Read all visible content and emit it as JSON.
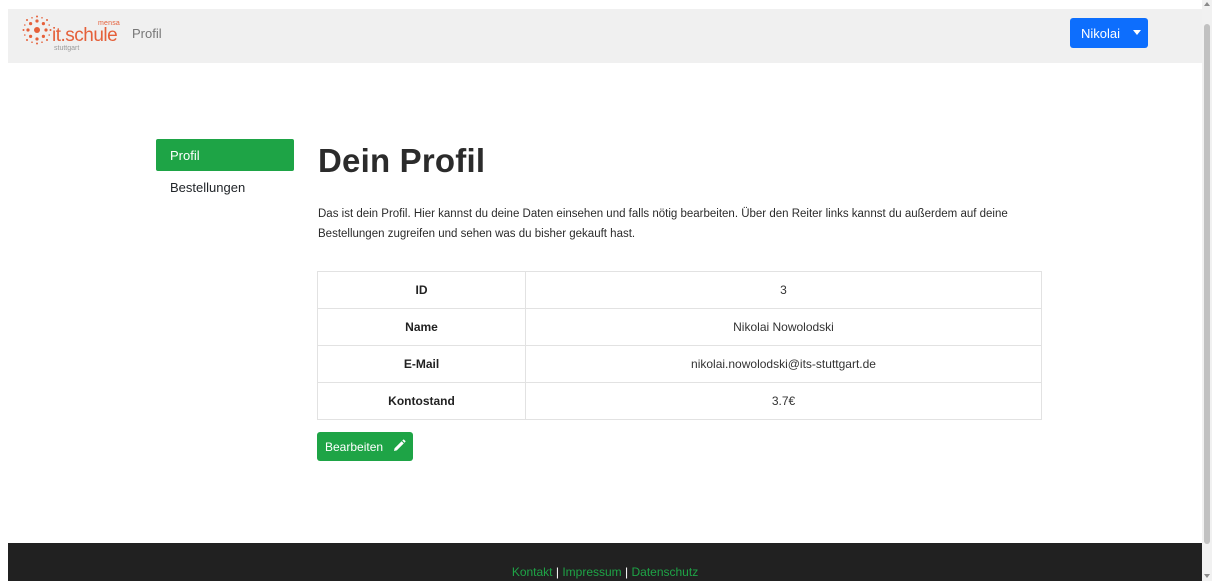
{
  "navbar": {
    "logo": {
      "mensa": "mensa",
      "itschule": "it.schule",
      "stuttgart": "stuttgart"
    },
    "page_title": "Profil",
    "user_menu": {
      "label": "Nikolai"
    }
  },
  "sidebar": {
    "items": [
      {
        "label": "Profil",
        "active": true
      },
      {
        "label": "Bestellungen",
        "active": false
      }
    ]
  },
  "main": {
    "title": "Dein Profil",
    "intro": "Das ist dein Profil. Hier kannst du deine Daten einsehen und falls nötig bearbeiten. Über den Reiter links kannst du außerdem auf deine Bestellungen zugreifen und sehen was du bisher gekauft hast.",
    "table": [
      {
        "key": "ID",
        "value": "3"
      },
      {
        "key": "Name",
        "value": "Nikolai Nowolodski"
      },
      {
        "key": "E-Mail",
        "value": "nikolai.nowolodski@its-stuttgart.de"
      },
      {
        "key": "Kontostand",
        "value": "3.7€"
      }
    ],
    "edit_button": {
      "label": "Bearbeiten",
      "icon": "pencil-icon"
    }
  },
  "footer": {
    "links": [
      "Kontakt",
      "Impressum",
      "Datenschutz"
    ],
    "separator": "|"
  },
  "colors": {
    "accent_green": "#1ea446",
    "user_button_blue": "#0d6efd",
    "logo_orange": "#e5603a",
    "footer_bg": "#212121"
  }
}
